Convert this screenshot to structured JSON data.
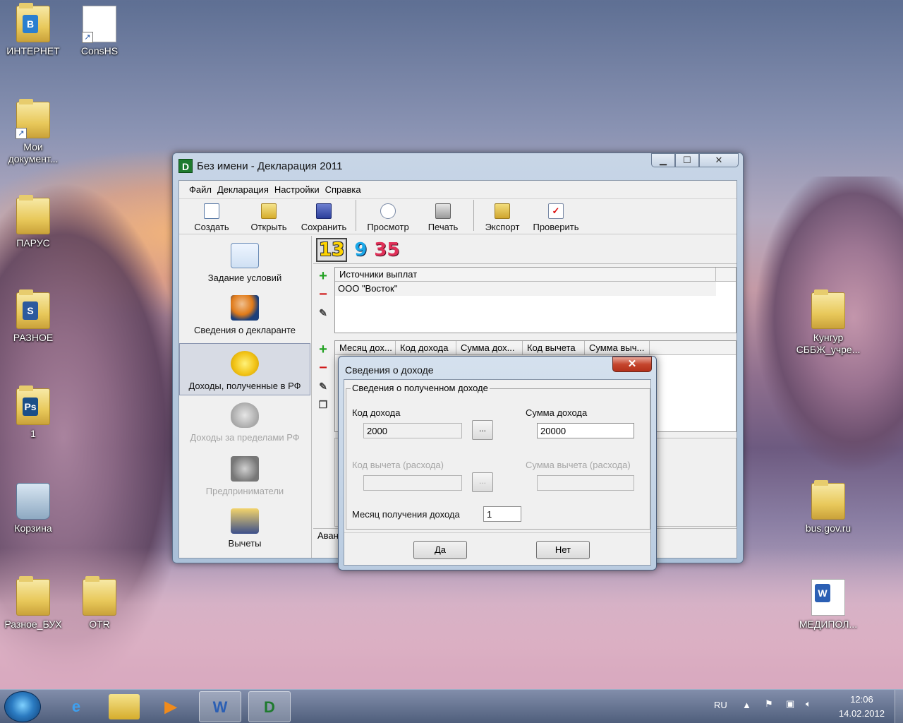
{
  "desktop": {
    "icons": [
      {
        "label": "ИНТЕРНЕТ"
      },
      {
        "label": "ConsHS"
      },
      {
        "label": "Мои документ..."
      },
      {
        "label": "ПАРУС"
      },
      {
        "label": "РАЗНОЕ"
      },
      {
        "label": "1"
      },
      {
        "label": "Корзина"
      },
      {
        "label": "Разное_БУХ"
      },
      {
        "label": "OTR"
      },
      {
        "label": "Кунгур СББЖ_учре..."
      },
      {
        "label": "bus.gov.ru"
      },
      {
        "label": "МЕДИПОЛ..."
      }
    ]
  },
  "window": {
    "title": "Без имени - Декларация 2011",
    "app_icon": "D",
    "menu": [
      "Файл",
      "Декларация",
      "Настройки",
      "Справка"
    ],
    "toolbar": {
      "create": "Создать",
      "open": "Открыть",
      "save": "Сохранить",
      "preview": "Просмотр",
      "print": "Печать",
      "export": "Экспорт",
      "check": "Проверить"
    },
    "nav": {
      "conditions": "Задание условий",
      "declarant": "Сведения о декларанте",
      "income_rf": "Доходы, полученные в РФ",
      "income_abroad": "Доходы за пределами РФ",
      "entrepreneurs": "Предприниматели",
      "deductions": "Вычеты"
    },
    "tax_rates": [
      "13",
      "9",
      "35"
    ],
    "sources_grid": {
      "header": "Источники выплат",
      "rows": [
        "ООО \"Восток\""
      ]
    },
    "income_grid": {
      "headers": [
        "Месяц дох...",
        "Код дохода",
        "Сумма дох...",
        "Код вычета",
        "Сумма выч..."
      ]
    },
    "status_text": "Аван"
  },
  "dialog": {
    "title": "Сведения о доходе",
    "group_title": "Сведения о полученном доходе",
    "income_code_label": "Код дохода",
    "income_code_value": "2000",
    "income_sum_label": "Сумма дохода",
    "income_sum_value": "20000",
    "deduction_code_label": "Код вычета (расхода)",
    "deduction_code_value": "",
    "deduction_sum_label": "Сумма вычета (расхода)",
    "deduction_sum_value": "",
    "month_label": "Месяц получения дохода",
    "month_value": "1",
    "ellipsis": "...",
    "ok": "Да",
    "cancel": "Нет"
  },
  "taskbar": {
    "lang": "RU",
    "time": "12:06",
    "date": "14.02.2012"
  }
}
